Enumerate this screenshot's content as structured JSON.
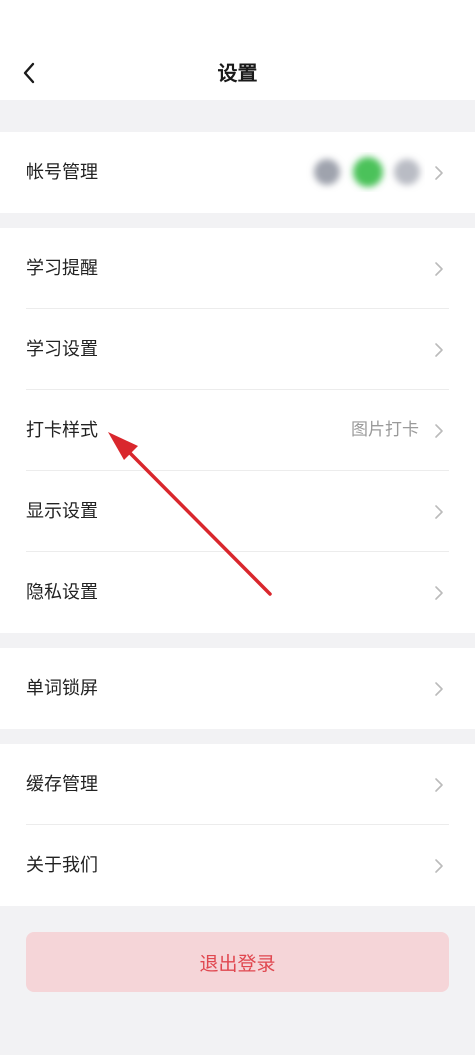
{
  "header": {
    "title": "设置",
    "back_icon": "chevron-left-icon"
  },
  "account": {
    "label": "帐号管理",
    "avatar_colors": [
      "#9fa3ad",
      "#4cc25a",
      "#b9bcc4"
    ]
  },
  "groups": [
    {
      "items": [
        {
          "label": "学习提醒",
          "value": ""
        },
        {
          "label": "学习设置",
          "value": ""
        },
        {
          "label": "打卡样式",
          "value": "图片打卡"
        },
        {
          "label": "显示设置",
          "value": ""
        },
        {
          "label": "隐私设置",
          "value": ""
        }
      ]
    },
    {
      "items": [
        {
          "label": "单词锁屏",
          "value": ""
        }
      ]
    },
    {
      "items": [
        {
          "label": "缓存管理",
          "value": ""
        },
        {
          "label": "关于我们",
          "value": ""
        }
      ]
    }
  ],
  "logout": {
    "label": "退出登录"
  },
  "colors": {
    "background": "#f2f2f4",
    "logout_bg": "#f5d5d8",
    "logout_text": "#e0474f",
    "annotation_arrow": "#d9272d"
  }
}
